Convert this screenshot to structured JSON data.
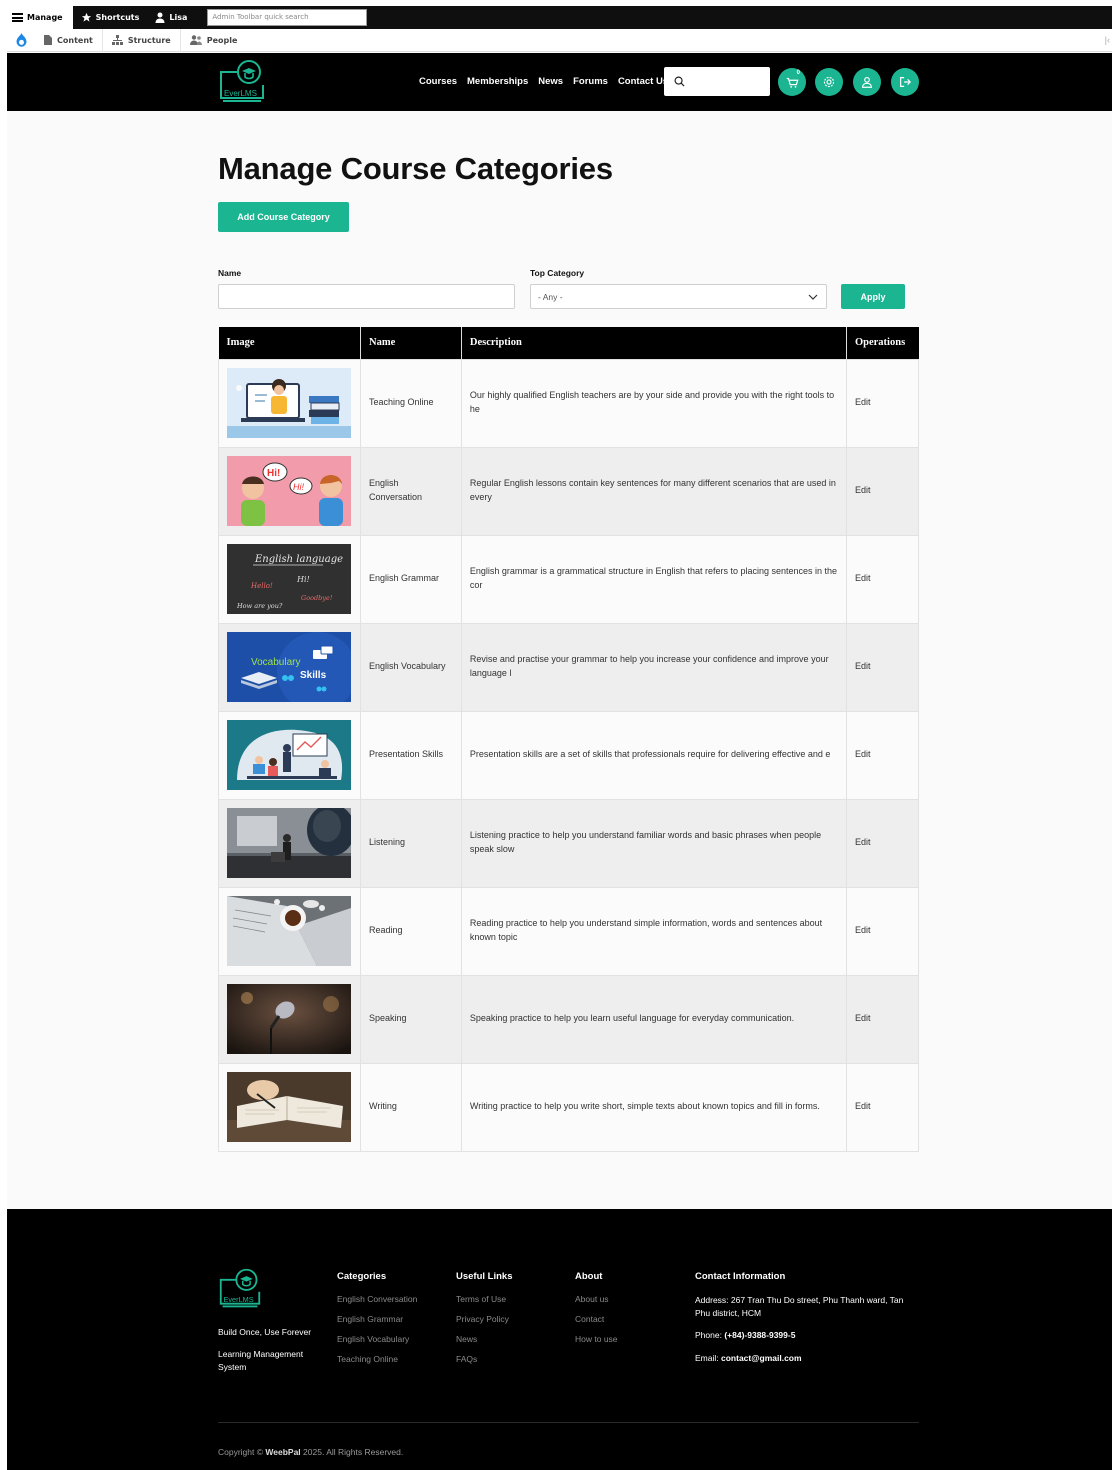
{
  "toolbar": {
    "manage": "Manage",
    "shortcuts": "Shortcuts",
    "user": "Lisa",
    "search_placeholder": "Admin Toolbar quick search",
    "content": "Content",
    "structure": "Structure",
    "people": "People"
  },
  "header": {
    "logo_text": "EverLMS",
    "nav": [
      "Courses",
      "Memberships",
      "News",
      "Forums",
      "Contact Us"
    ],
    "cart_count": "0"
  },
  "page": {
    "title": "Manage Course Categories",
    "add_button": "Add Course Category"
  },
  "filters": {
    "name_label": "Name",
    "name_value": "",
    "top_category_label": "Top Category",
    "top_category_value": "- Any -",
    "apply_label": "Apply"
  },
  "table": {
    "headers": [
      "Image",
      "Name",
      "Description",
      "Operations"
    ],
    "rows": [
      {
        "name": "Teaching Online",
        "description": "Our highly qualified English teachers are by your side and provide you with the right tools to he",
        "operation": "Edit",
        "thumb": "teacher-laptop-illustration"
      },
      {
        "name": "English Conversation",
        "description": "Regular English lessons contain key sentences for many different scenarios that are used in every",
        "operation": "Edit",
        "thumb": "conversation-illustration"
      },
      {
        "name": "English Grammar",
        "description": "English grammar is a grammatical structure in English that refers to placing sentences in the cor",
        "operation": "Edit",
        "thumb": "chalkboard"
      },
      {
        "name": "English Vocabulary",
        "description": "Revise and practise your grammar to help you increase your confidence and improve your language l",
        "operation": "Edit",
        "thumb": "vocabulary-skills"
      },
      {
        "name": "Presentation Skills",
        "description": "Presentation skills are a set of skills that professionals require for delivering effective and e",
        "operation": "Edit",
        "thumb": "presentation-illustration"
      },
      {
        "name": "Listening",
        "description": "Listening practice to help you understand familiar words and basic phrases when people speak slow",
        "operation": "Edit",
        "thumb": "lecture-photo"
      },
      {
        "name": "Reading",
        "description": "Reading practice to help you understand simple information, words and sentences about known topic",
        "operation": "Edit",
        "thumb": "coffee-papers-photo"
      },
      {
        "name": "Speaking",
        "description": "Speaking practice to help you learn useful language for everyday communication.",
        "operation": "Edit",
        "thumb": "microphone-photo"
      },
      {
        "name": "Writing",
        "description": "Writing practice to help you write short, simple texts about known topics and fill in forms.",
        "operation": "Edit",
        "thumb": "writing-photo"
      }
    ],
    "thumb_text": {
      "conversation_hi": "Hi!",
      "conversation_hola": "Hi!",
      "chalk_title": "English language",
      "chalk_hi": "Hi!",
      "chalk_hello": "Hello!",
      "chalk_goodbye": "Goodbye!",
      "chalk_how": "How are you?",
      "vocab_1": "Vocabulary",
      "vocab_2": "Skills"
    }
  },
  "footer": {
    "tagline_1": "Build Once, Use Forever",
    "tagline_2": "Learning Management System",
    "categories_title": "Categories",
    "categories": [
      "English Conversation",
      "English Grammar",
      "English Vocabulary",
      "Teaching Online"
    ],
    "links_title": "Useful Links",
    "links": [
      "Terms of Use",
      "Privacy Policy",
      "News",
      "FAQs"
    ],
    "about_title": "About",
    "about": [
      "About us",
      "Contact",
      "How to use"
    ],
    "contact_title": "Contact Information",
    "address_label": "Address:",
    "address": "267 Tran Thu Do street, Phu Thanh ward, Tan Phu district, HCM",
    "phone_label": "Phone:",
    "phone": "(+84)-9388-9399-5",
    "email_label": "Email:",
    "email": "contact@gmail.com",
    "copyright_pre": "Copyright ©",
    "copyright_brand": "WeebPal",
    "copyright_post": "2025. All Rights Reserved."
  },
  "colors": {
    "accent": "#1bb592",
    "header_bg": "#000000",
    "row_alt": "#eeeeee"
  }
}
